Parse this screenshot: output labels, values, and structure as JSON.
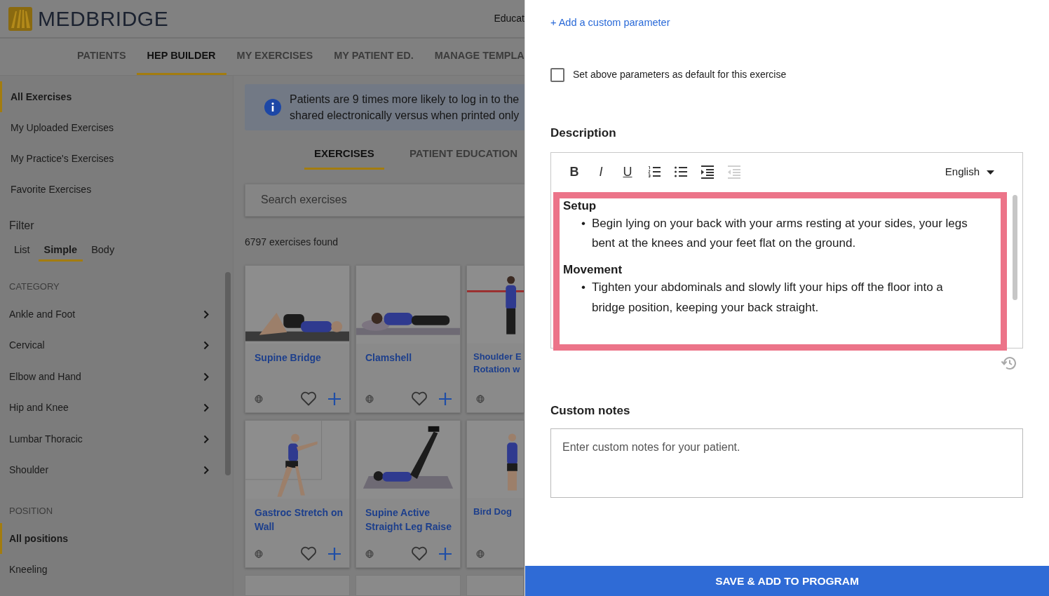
{
  "header": {
    "logo_text": "MEDBRIDGE",
    "top_link": "Educat"
  },
  "nav_tabs": [
    {
      "label": "PATIENTS",
      "selected": false
    },
    {
      "label": "HEP BUILDER",
      "selected": true
    },
    {
      "label": "MY EXERCISES",
      "selected": false
    },
    {
      "label": "MY PATIENT ED.",
      "selected": false
    },
    {
      "label": "MANAGE TEMPLA",
      "selected": false
    }
  ],
  "sidebar": {
    "libraries": [
      {
        "label": "All Exercises",
        "selected": true
      },
      {
        "label": "My Uploaded Exercises",
        "selected": false
      },
      {
        "label": "My Practice's Exercises",
        "selected": false
      },
      {
        "label": "Favorite Exercises",
        "selected": false
      }
    ],
    "filter_title": "Filter",
    "filter_tabs": [
      {
        "label": "List",
        "selected": false
      },
      {
        "label": "Simple",
        "selected": true
      },
      {
        "label": "Body",
        "selected": false
      }
    ],
    "category_heading": "CATEGORY",
    "categories": [
      {
        "label": "Ankle and Foot"
      },
      {
        "label": "Cervical"
      },
      {
        "label": "Elbow and Hand"
      },
      {
        "label": "Hip and Knee"
      },
      {
        "label": "Lumbar Thoracic"
      },
      {
        "label": "Shoulder"
      }
    ],
    "position_heading": "POSITION",
    "positions": [
      {
        "label": "All positions",
        "selected": true
      },
      {
        "label": "Kneeling",
        "selected": false
      }
    ]
  },
  "main": {
    "banner_lines": [
      "Patients are 9 times more likely to log in to the",
      "shared electronically versus when printed only"
    ],
    "subtabs": [
      {
        "label": "EXERCISES",
        "selected": true
      },
      {
        "label": "PATIENT EDUCATION",
        "selected": false
      }
    ],
    "search": {
      "placeholder": "Search exercises"
    },
    "count": "6797 exercises found",
    "exercises": [
      {
        "kind": "full",
        "title_lines": [
          "Supine Bridge"
        ]
      },
      {
        "kind": "full",
        "title_lines": [
          "Clamshell"
        ]
      },
      {
        "kind": "clipped",
        "title_lines": [
          "Shoulder E",
          "Rotation w"
        ]
      },
      {
        "kind": "full",
        "title_lines": [
          "Gastroc Stretch on",
          "Wall"
        ]
      },
      {
        "kind": "full",
        "title_lines": [
          "Supine Active",
          "Straight Leg Raise"
        ]
      },
      {
        "kind": "clipped",
        "title_lines": [
          "Bird Dog"
        ]
      }
    ]
  },
  "panel": {
    "add_parameter_link": "+ Add a custom parameter",
    "default_checkbox": {
      "label": "Set above parameters as default for this exercise",
      "checked": false
    },
    "description_heading": "Description",
    "toolbar": [
      {
        "kind": "bold",
        "label": "B",
        "disabled": false
      },
      {
        "kind": "italic",
        "label": "I",
        "disabled": false
      },
      {
        "kind": "underline",
        "label": "U",
        "disabled": false
      },
      {
        "kind": "numbered",
        "disabled": false
      },
      {
        "kind": "bulleted",
        "disabled": false
      },
      {
        "kind": "indent",
        "disabled": false
      },
      {
        "kind": "outdent",
        "disabled": true
      }
    ],
    "language": "English",
    "sections": [
      {
        "heading": "Setup",
        "bullets": [
          {
            "marker": "•",
            "text": "Begin lying on your back with your arms resting at your sides, your legs bent at the knees and your feet flat on the ground."
          }
        ]
      },
      {
        "heading": "Movement",
        "bullets": [
          {
            "marker": "•",
            "text": "Tighten your abdominals and slowly lift your hips off the floor into a bridge position, keeping your back straight."
          }
        ]
      }
    ],
    "custom_notes_heading": "Custom notes",
    "notes": {
      "placeholder": "Enter custom notes for your patient."
    },
    "save_button": "SAVE & ADD TO PROGRAM"
  }
}
